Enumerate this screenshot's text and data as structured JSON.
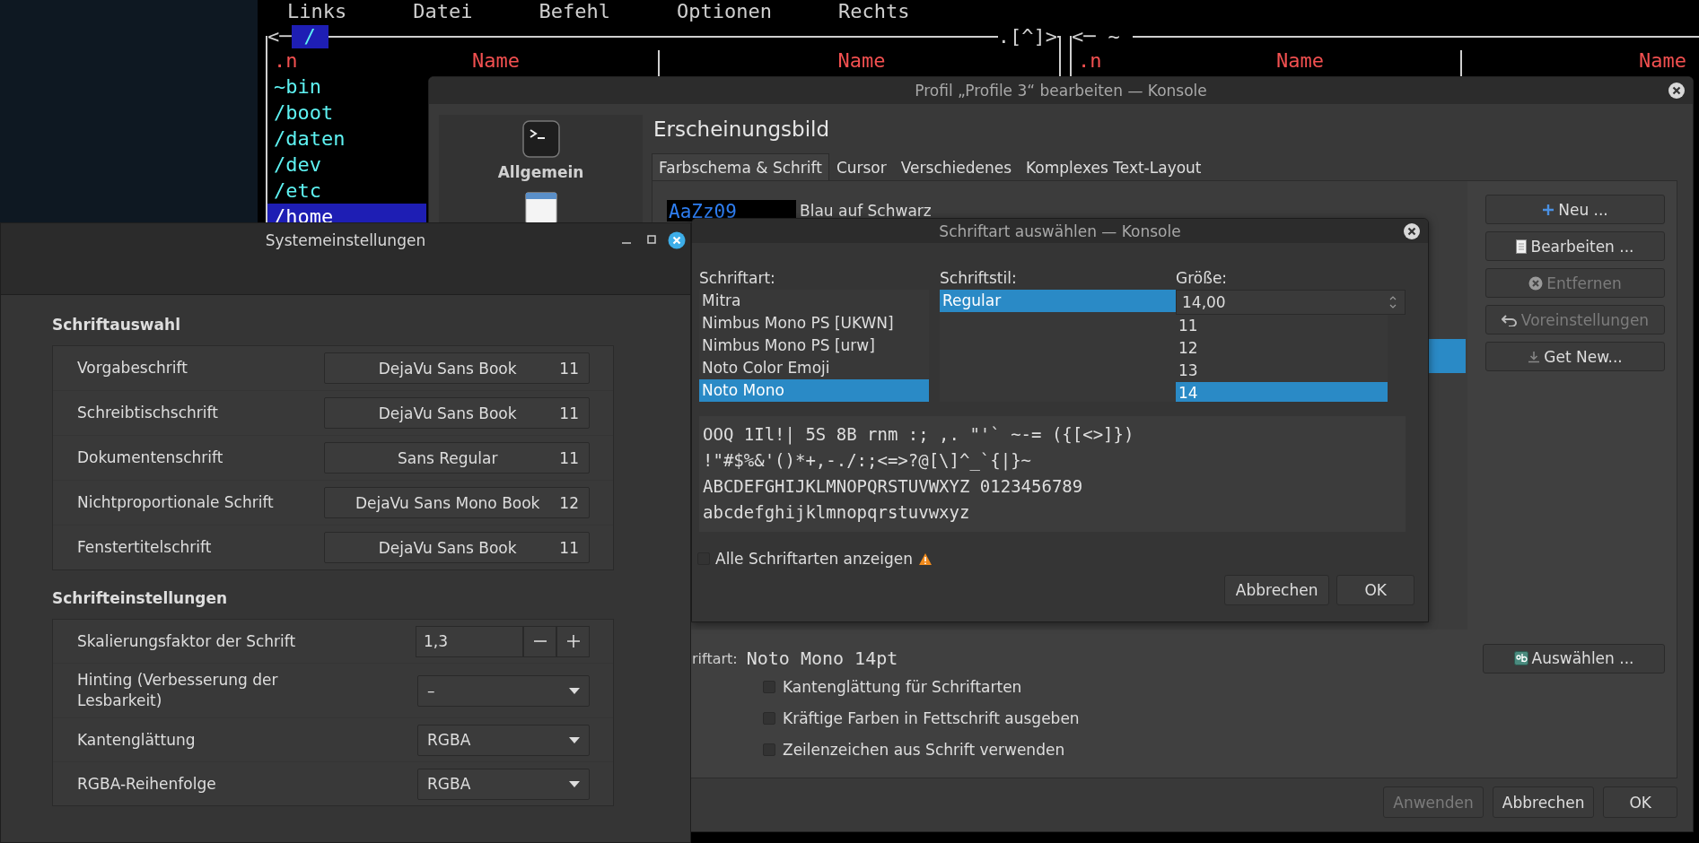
{
  "terminal": {
    "menu": [
      "Links",
      "Datei",
      "Befehl",
      "Optionen",
      "Rechts"
    ],
    "left_panel": {
      "nav_left": "<─",
      "path": "/",
      "nav_right": ".[^]>",
      "headers": [
        ".n",
        "Name",
        "Name"
      ],
      "entries": [
        {
          "name": "~bin",
          "selected": false
        },
        {
          "name": "/boot",
          "selected": false
        },
        {
          "name": "/daten",
          "selected": false
        },
        {
          "name": "/dev",
          "selected": false
        },
        {
          "name": "/etc",
          "selected": false
        },
        {
          "name": "/home",
          "selected": true
        }
      ]
    },
    "right_panel": {
      "nav_left": "<─",
      "path": "~",
      "headers": [
        ".n",
        "Name",
        "Name"
      ]
    }
  },
  "profile_dialog": {
    "title": "Profil „Profile 3“ bearbeiten — Konsole",
    "sidebar": [
      {
        "kind": "terminal",
        "label": "Allgemein"
      },
      {
        "kind": "window"
      }
    ],
    "heading": "Erscheinungsbild",
    "tabs": [
      {
        "label": "Farbschema & Schrift",
        "selected": true
      },
      {
        "label": "Cursor",
        "selected": false
      },
      {
        "label": "Verschiedenes",
        "selected": false
      },
      {
        "label": "Komplexes Text-Layout",
        "selected": false
      }
    ],
    "scheme": {
      "preview": "AaZz09",
      "name": "Blau auf Schwarz"
    },
    "buttons": [
      {
        "kind": "new",
        "label": "Neu ...",
        "disabled": false
      },
      {
        "kind": "edit",
        "label": "Bearbeiten ...",
        "disabled": false
      },
      {
        "kind": "remove",
        "label": "Entfernen",
        "disabled": true
      },
      {
        "kind": "reset",
        "label": "Voreinstellungen",
        "disabled": true
      },
      {
        "kind": "download",
        "label": "Get New...",
        "disabled": false
      }
    ],
    "font_label": "riftart:",
    "font_value": "Noto Mono 14pt",
    "choose_button": "Auswählen ...",
    "options": [
      {
        "label": "Kantenglättung für Schriftarten",
        "checked": false
      },
      {
        "label": "Kräftige Farben in Fettschrift ausgeben",
        "checked": false
      },
      {
        "label": "Zeilenzeichen aus Schrift verwenden",
        "checked": false
      }
    ],
    "footer_buttons": [
      {
        "label": "Anwenden",
        "disabled": true
      },
      {
        "label": "Abbrechen",
        "disabled": false
      },
      {
        "label": "OK",
        "disabled": false
      }
    ]
  },
  "font_dialog": {
    "title": "Schriftart auswählen — Konsole",
    "family": {
      "label": "Schriftart:",
      "items": [
        {
          "label": "Mitra",
          "selected": false
        },
        {
          "label": "Nimbus Mono PS [UKWN]",
          "selected": false
        },
        {
          "label": "Nimbus Mono PS [urw]",
          "selected": false
        },
        {
          "label": "Noto Color Emoji",
          "selected": false
        },
        {
          "label": "Noto Mono",
          "selected": true
        }
      ]
    },
    "style": {
      "label": "Schriftstil:",
      "items": [
        {
          "label": "Regular",
          "selected": true
        }
      ]
    },
    "size": {
      "label": "Größe:",
      "value": "14,00",
      "items": [
        {
          "label": "11",
          "selected": false
        },
        {
          "label": "12",
          "selected": false
        },
        {
          "label": "13",
          "selected": false
        },
        {
          "label": "14",
          "selected": true
        }
      ]
    },
    "preview": [
      "OOQ 1Il!| 5S 8B rnm :; ,. \"'` ~-= ({[<>]})",
      "!\"#$%&'()*+,-./:;<=>?@[\\]^_`{|}~",
      "ABCDEFGHIJKLMNOPQRSTUVWXYZ 0123456789",
      "abcdefghijklmnopqrstuvwxyz"
    ],
    "show_all": {
      "label": "Alle Schriftarten anzeigen",
      "checked": false
    },
    "buttons": [
      "Abbrechen",
      "OK"
    ]
  },
  "system_settings": {
    "title": "Systemeinstellungen",
    "sections": [
      {
        "title": "Schriftauswahl",
        "rows": [
          {
            "kind": "font",
            "label": "Vorgabeschrift",
            "font": "DejaVu Sans Book",
            "size": "11"
          },
          {
            "kind": "font",
            "label": "Schreibtischschrift",
            "font": "DejaVu Sans Book",
            "size": "11"
          },
          {
            "kind": "font",
            "label": "Dokumentenschrift",
            "font": "Sans Regular",
            "size": "11"
          },
          {
            "kind": "font",
            "label": "Nichtproportionale Schrift",
            "font": "DejaVu Sans Mono Book",
            "size": "12"
          },
          {
            "kind": "font",
            "label": "Fenstertitelschrift",
            "font": "DejaVu Sans Book",
            "size": "11"
          }
        ]
      },
      {
        "title": "Schrifteinstellungen",
        "rows": [
          {
            "kind": "spin",
            "label": "Skalierungsfaktor der Schrift",
            "value": "1,3"
          },
          {
            "kind": "combo",
            "label": "Hinting (Verbesserung der Lesbarkeit)",
            "value": "–"
          },
          {
            "kind": "combo",
            "label": "Kantenglättung",
            "value": "RGBA"
          },
          {
            "kind": "combo",
            "label": "RGBA-Reihenfolge",
            "value": "RGBA"
          }
        ]
      }
    ]
  }
}
